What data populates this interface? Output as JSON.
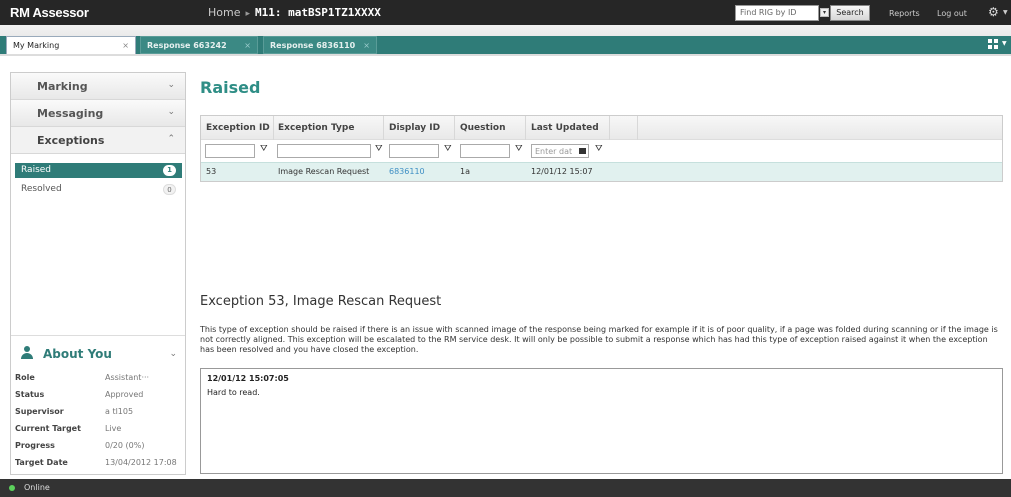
{
  "app": {
    "title": "RM Assessor"
  },
  "breadcrumb": {
    "home": "Home",
    "separator": "▸",
    "current": "M11: matBSP1TZ1XXXX"
  },
  "topbar": {
    "find_placeholder": "Find RIG by ID",
    "search_label": "Search",
    "reports_label": "Reports",
    "logout_label": "Log out"
  },
  "tabs": [
    {
      "label": "My Marking",
      "close": "×"
    },
    {
      "label": "Response 663242",
      "close": "×"
    },
    {
      "label": "Response 6836110",
      "close": "×"
    }
  ],
  "sidebar": {
    "sections": [
      {
        "label": "Marking",
        "chevron": "⌄"
      },
      {
        "label": "Messaging",
        "chevron": "⌄"
      },
      {
        "label": "Exceptions",
        "chevron": "⌃"
      }
    ],
    "items": [
      {
        "label": "Raised",
        "count": "1"
      },
      {
        "label": "Resolved",
        "count": "0"
      }
    ],
    "about": {
      "label": "About You",
      "chevron": "⌄",
      "rows": [
        {
          "key": "Role",
          "value": "Assistant···"
        },
        {
          "key": "Status",
          "value": "Approved"
        },
        {
          "key": "Supervisor",
          "value": "a tl105"
        },
        {
          "key": "Current Target",
          "value": "Live"
        },
        {
          "key": "Progress",
          "value": "0/20 (0%)"
        },
        {
          "key": "Target Date",
          "value": "13/04/2012 17:08"
        }
      ]
    }
  },
  "main": {
    "title": "Raised",
    "grid": {
      "columns": [
        "Exception ID",
        "Exception Type",
        "Display ID",
        "Question",
        "Last Updated"
      ],
      "date_filter_placeholder": "Enter dat",
      "rows": [
        {
          "exception_id": "53",
          "exception_type": "Image Rescan Request",
          "display_id": "6836110",
          "question": "1a",
          "last_updated": "12/01/12 15:07"
        }
      ]
    },
    "detail": {
      "title": "Exception 53,  Image Rescan Request",
      "description": "This type of exception should be raised if there is an issue with scanned image of the response being marked for example if it is of poor quality, if a page was folded during scanning or if the image is not correctly aligned. This exception will be escalated to the RM service desk. It will only be possible to submit a response which has had this type of exception raised against it when the exception has been resolved and you have closed the exception.",
      "note_timestamp": "12/01/12 15:07:05",
      "note_text": "Hard to read."
    }
  },
  "status": {
    "label": "Online"
  },
  "colors": {
    "accent": "#2f7c78",
    "title": "#2f8e86",
    "selected_row": "#e1f1ef",
    "link": "#3f8fc4",
    "online": "#5cd15c"
  }
}
